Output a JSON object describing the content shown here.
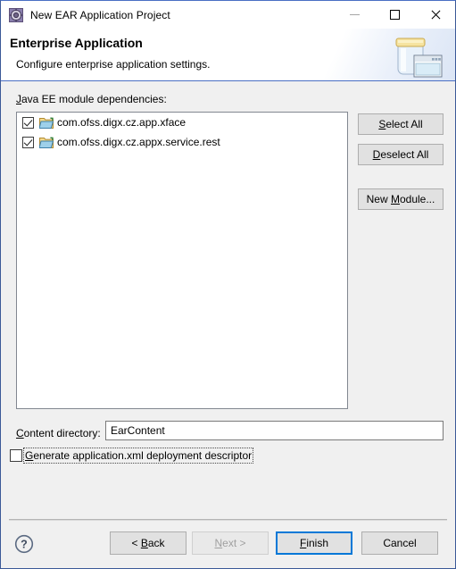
{
  "window": {
    "title": "New EAR Application Project",
    "icon": "project-gear-icon",
    "controls": {
      "minimize": "minimize-icon",
      "maximize": "maximize-icon",
      "close": "close-icon"
    }
  },
  "header": {
    "title": "Enterprise Application",
    "subtitle": "Configure enterprise application settings.",
    "art": "jar-with-window-icon"
  },
  "main": {
    "modules_label": "Java EE module dependencies:",
    "modules_label_mnemonic": "J",
    "modules": [
      {
        "name": "com.ofss.digx.cz.app.xface",
        "checked": true,
        "icon": "folder-icon"
      },
      {
        "name": "com.ofss.digx.cz.appx.service.rest",
        "checked": true,
        "icon": "folder-icon"
      }
    ],
    "side_buttons": [
      {
        "label": "Select All",
        "mnemonic": "S",
        "enabled": true
      },
      {
        "label": "Deselect All",
        "mnemonic": "D",
        "enabled": true
      },
      {
        "label": "New Module...",
        "mnemonic": "M",
        "enabled": true
      }
    ],
    "content_directory": {
      "label": "Content directory:",
      "mnemonic": "C",
      "value": "EarContent",
      "placeholder": ""
    },
    "generate_descriptor": {
      "label": "Generate application.xml deployment descriptor",
      "mnemonic": "G",
      "checked": false,
      "focused": true
    }
  },
  "footer": {
    "help": "help-icon",
    "buttons": [
      {
        "label": "< Back",
        "mnemonic": "B",
        "enabled": true,
        "default": false
      },
      {
        "label": "Next >",
        "mnemonic": "N",
        "enabled": false,
        "default": false
      },
      {
        "label": "Finish",
        "mnemonic": "F",
        "enabled": true,
        "default": true
      },
      {
        "label": "Cancel",
        "mnemonic": "",
        "enabled": true,
        "default": false
      }
    ]
  },
  "colors": {
    "accent": "#0078d7",
    "window_border": "#3b5998",
    "dialog_bg": "#f0f0f0",
    "header_bg": "#ffffff",
    "button_bg": "#e1e1e1",
    "field_bg": "#ffffff"
  }
}
